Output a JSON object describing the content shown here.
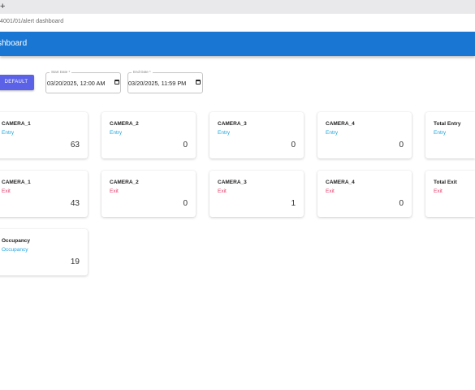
{
  "browser": {
    "new_tab_symbol": "+",
    "url": "4001/01/alert dashboard"
  },
  "appbar": {
    "title": "shboard"
  },
  "filters": {
    "default_label": "DEFAULT",
    "start_label": "Start Date *",
    "start_value": "03/20/2025, 12:00 AM",
    "end_label": "End Date *",
    "end_value": "03/20/2025, 11:59 PM",
    "calendar_icon": "calendar-icon"
  },
  "entry_cards": [
    {
      "name": "CAMERA_1",
      "type": "Entry",
      "count": "63"
    },
    {
      "name": "CAMERA_2",
      "type": "Entry",
      "count": "0"
    },
    {
      "name": "CAMERA_3",
      "type": "Entry",
      "count": "0"
    },
    {
      "name": "CAMERA_4",
      "type": "Entry",
      "count": "0"
    },
    {
      "name": "Total Entry",
      "type": "Entry",
      "count": ""
    }
  ],
  "exit_cards": [
    {
      "name": "CAMERA_1",
      "type": "Exit",
      "count": "43"
    },
    {
      "name": "CAMERA_2",
      "type": "Exit",
      "count": "0"
    },
    {
      "name": "CAMERA_3",
      "type": "Exit",
      "count": "1"
    },
    {
      "name": "CAMERA_4",
      "type": "Exit",
      "count": "0"
    },
    {
      "name": "Total Exit",
      "type": "Exit",
      "count": ""
    }
  ],
  "occupancy_card": {
    "name": "Occupancy",
    "type": "Occupancy",
    "count": "19"
  },
  "colors": {
    "appbar": "#1976d2",
    "button": "#5b62e8",
    "entry": "#1ea5e0",
    "exit": "#e53e6b"
  }
}
